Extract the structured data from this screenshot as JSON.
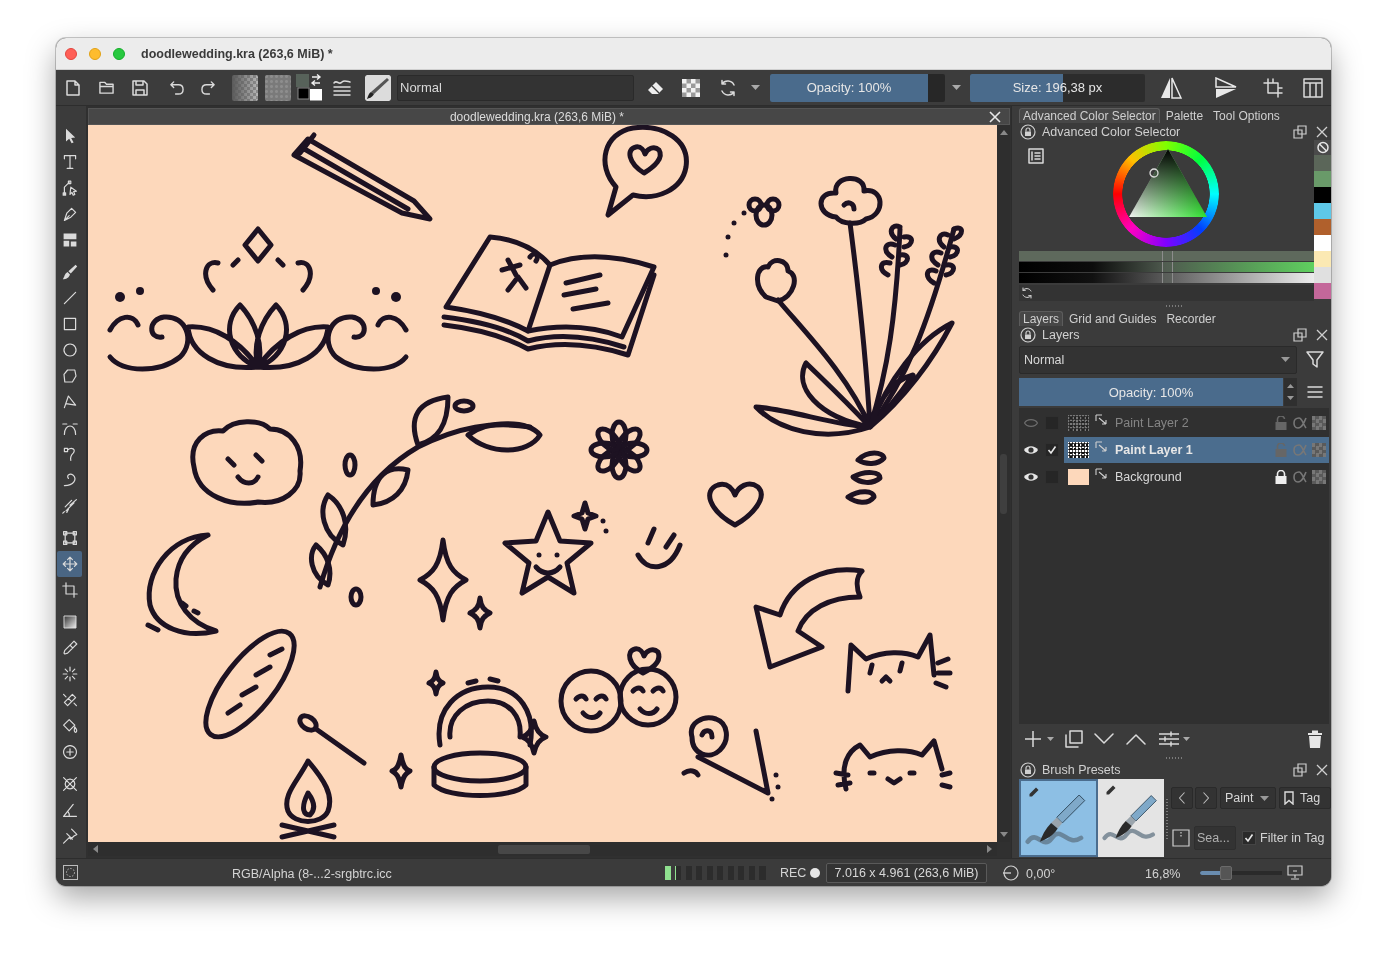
{
  "window": {
    "title": "doodlewedding.kra (263,6 MiB) *"
  },
  "toolbar": {
    "blend_mode": "Normal",
    "opacity": {
      "label": "Opacity: 100%",
      "level": 1
    },
    "size": {
      "label": "Size: 196,38 px",
      "level": 0.53
    }
  },
  "toolbox": {
    "groups": [
      [
        {
          "selected": false
        },
        {
          "selected": false
        },
        {
          "selected": false
        },
        {
          "selected": false
        },
        {
          "selected": false
        }
      ],
      [
        {
          "selected": false
        },
        {
          "selected": false
        },
        {
          "selected": false
        },
        {
          "selected": false
        },
        {
          "selected": false
        },
        {
          "selected": false
        },
        {
          "selected": false
        },
        {
          "selected": false
        },
        {
          "selected": false
        },
        {
          "selected": false
        }
      ],
      [
        {
          "selected": false
        },
        {
          "selected": true
        },
        {
          "selected": false
        }
      ],
      [
        {
          "selected": false
        },
        {
          "selected": false
        },
        {
          "selected": false
        },
        {
          "selected": false
        },
        {
          "selected": false
        },
        {
          "selected": false
        }
      ],
      [
        {
          "selected": false
        },
        {
          "selected": false
        },
        {
          "selected": false
        }
      ]
    ]
  },
  "document": {
    "title": "doodlewedding.kra (263,6 MiB) *"
  },
  "color_docker": {
    "tabs": [
      {
        "label": "Advanced Color Selector",
        "selected": true
      },
      {
        "label": "Palette",
        "selected": false
      },
      {
        "label": "Tool Options",
        "selected": false
      }
    ],
    "title": "Advanced Color Selector",
    "sliders": [
      {
        "level": 0.5
      },
      {
        "level": 0.5
      },
      {
        "level": 0.5
      }
    ],
    "recent_colors": [
      {
        "color": "#5b6659"
      },
      {
        "color": "#699a69"
      },
      {
        "color": "#000000"
      },
      {
        "color": "#5ec8e8"
      },
      {
        "color": "#b0602c"
      },
      {
        "color": "#ffffff"
      },
      {
        "color": "#fbe9b3"
      },
      {
        "color": "#e0e0e0"
      },
      {
        "color": "#c4679a"
      }
    ]
  },
  "layers_docker": {
    "tabs": [
      {
        "label": "Layers",
        "selected": true
      },
      {
        "label": "Grid and Guides",
        "selected": false
      },
      {
        "label": "Recorder",
        "selected": false
      }
    ],
    "title": "Layers",
    "blend_mode": "Normal",
    "opacity": {
      "label": "Opacity: 100%",
      "level": 1
    },
    "layers": [
      {
        "name": "Paint Layer 2",
        "kind": "paint",
        "visible": false,
        "checked": false,
        "locked": false,
        "selected": false
      },
      {
        "name": "Paint Layer 1",
        "kind": "paint",
        "visible": true,
        "checked": true,
        "locked": false,
        "selected": true
      },
      {
        "name": "Background",
        "kind": "background",
        "visible": true,
        "checked": false,
        "locked": true,
        "selected": false
      }
    ]
  },
  "brush_presets": {
    "title": "Brush Presets",
    "presets": [
      {
        "selected": true
      },
      {
        "selected": false
      }
    ],
    "tag": "Paint",
    "tag_button": "Tag",
    "search": {
      "placeholder": "Sea..."
    },
    "filter_in_tag": {
      "label": "Filter in Tag",
      "checked": true
    }
  },
  "status_bar": {
    "color_profile": "RGB/Alpha (8-...2-srgbtrc.icc",
    "memory": {
      "level": 0.1
    },
    "recording": "REC",
    "image_size": "7.016 x 4.961 (263,6 MiB)",
    "rotation": "0,00°",
    "zoom": "16,8%",
    "zoom_slider": {
      "level": 0.32
    }
  }
}
